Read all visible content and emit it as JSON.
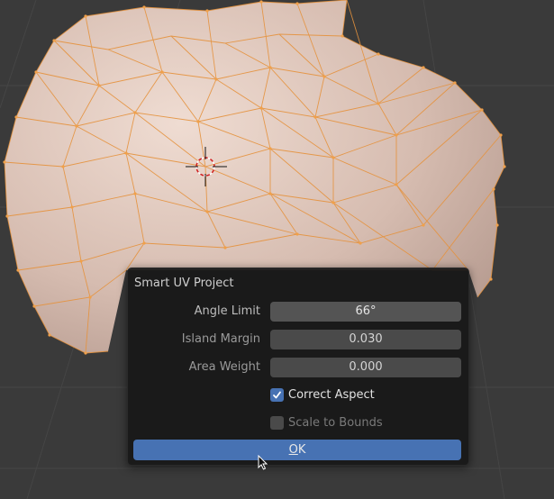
{
  "viewport": {
    "background": "#3a3a3a",
    "mesh_fill": "#d8c1b5",
    "wire_color": "#e5923d",
    "cursor_icon": "3d-cursor-icon"
  },
  "dialog": {
    "title": "Smart UV Project",
    "angle_limit": {
      "label": "Angle Limit",
      "value": "66°"
    },
    "island_margin": {
      "label": "Island Margin",
      "value": "0.030"
    },
    "area_weight": {
      "label": "Area Weight",
      "value": "0.000"
    },
    "correct_aspect": {
      "label": "Correct Aspect",
      "checked": true
    },
    "scale_to_bounds": {
      "label": "Scale to Bounds",
      "checked": false
    },
    "ok": {
      "underlined": "O",
      "rest": "K"
    },
    "accent": "#4772b3"
  }
}
